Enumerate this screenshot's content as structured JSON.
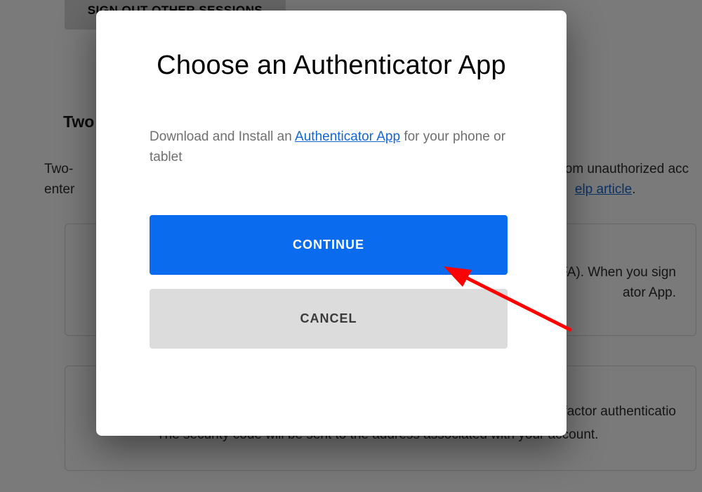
{
  "background": {
    "signout_button_label": "SIGN OUT OTHER SESSIONS",
    "section_title_fragment": "Two",
    "description_left": "Two-",
    "description_left_line2": "enter",
    "description_right": "om unauthorized acc",
    "help_link_label": "elp article",
    "card1_line1_right": "2FA). When you sign",
    "card1_line2_right": "ator App.",
    "card2_line1_right": "-factor authenticatio",
    "card2_line2": "The security code will be sent to the address associated with your account."
  },
  "modal": {
    "title": "Choose an Authenticator App",
    "description_before": "Download and Install an ",
    "description_link": "Authenticator App",
    "description_after": " for your phone or tablet",
    "continue_label": "CONTINUE",
    "cancel_label": "CANCEL"
  }
}
